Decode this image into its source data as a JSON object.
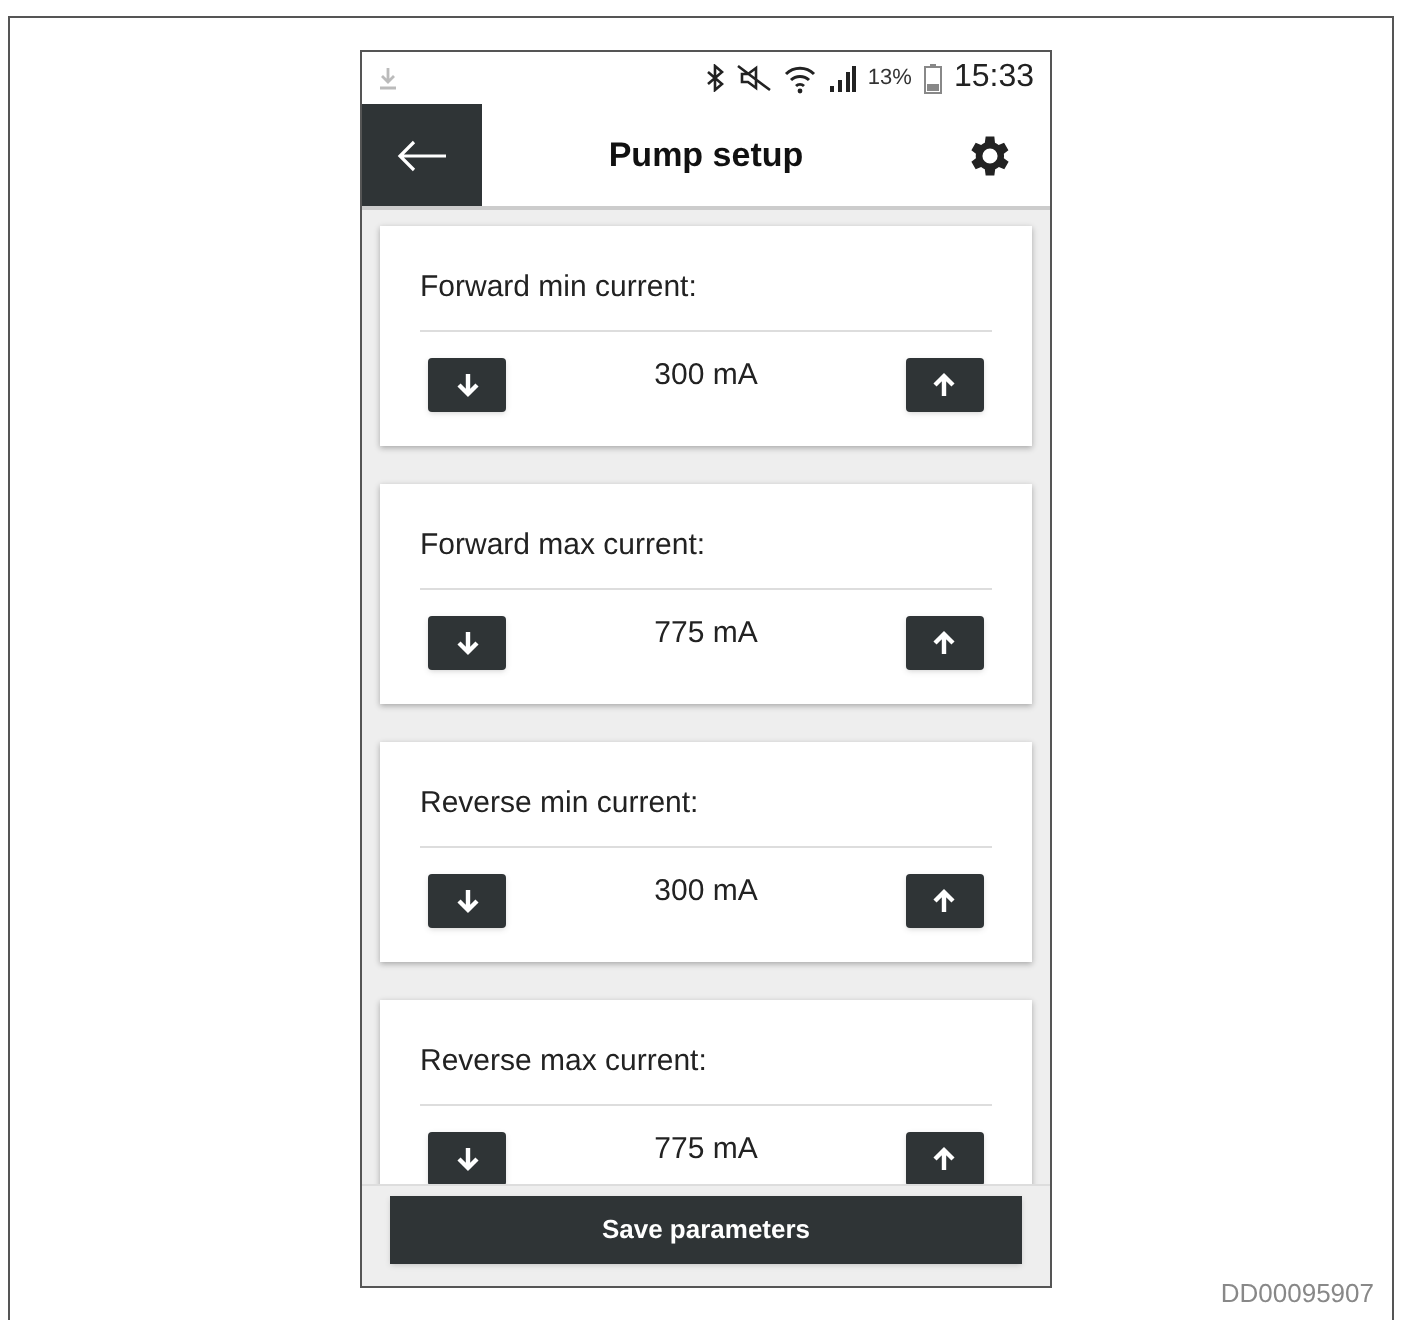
{
  "status_bar": {
    "battery": "13%",
    "time": "15:33"
  },
  "header": {
    "title": "Pump setup"
  },
  "settings": [
    {
      "label": "Forward min current:",
      "value": "300 mA"
    },
    {
      "label": "Forward max current:",
      "value": "775 mA"
    },
    {
      "label": "Reverse min current:",
      "value": "300 mA"
    },
    {
      "label": "Reverse max current:",
      "value": "775 mA"
    }
  ],
  "save_button": "Save parameters",
  "figure_code": "DD00095907"
}
